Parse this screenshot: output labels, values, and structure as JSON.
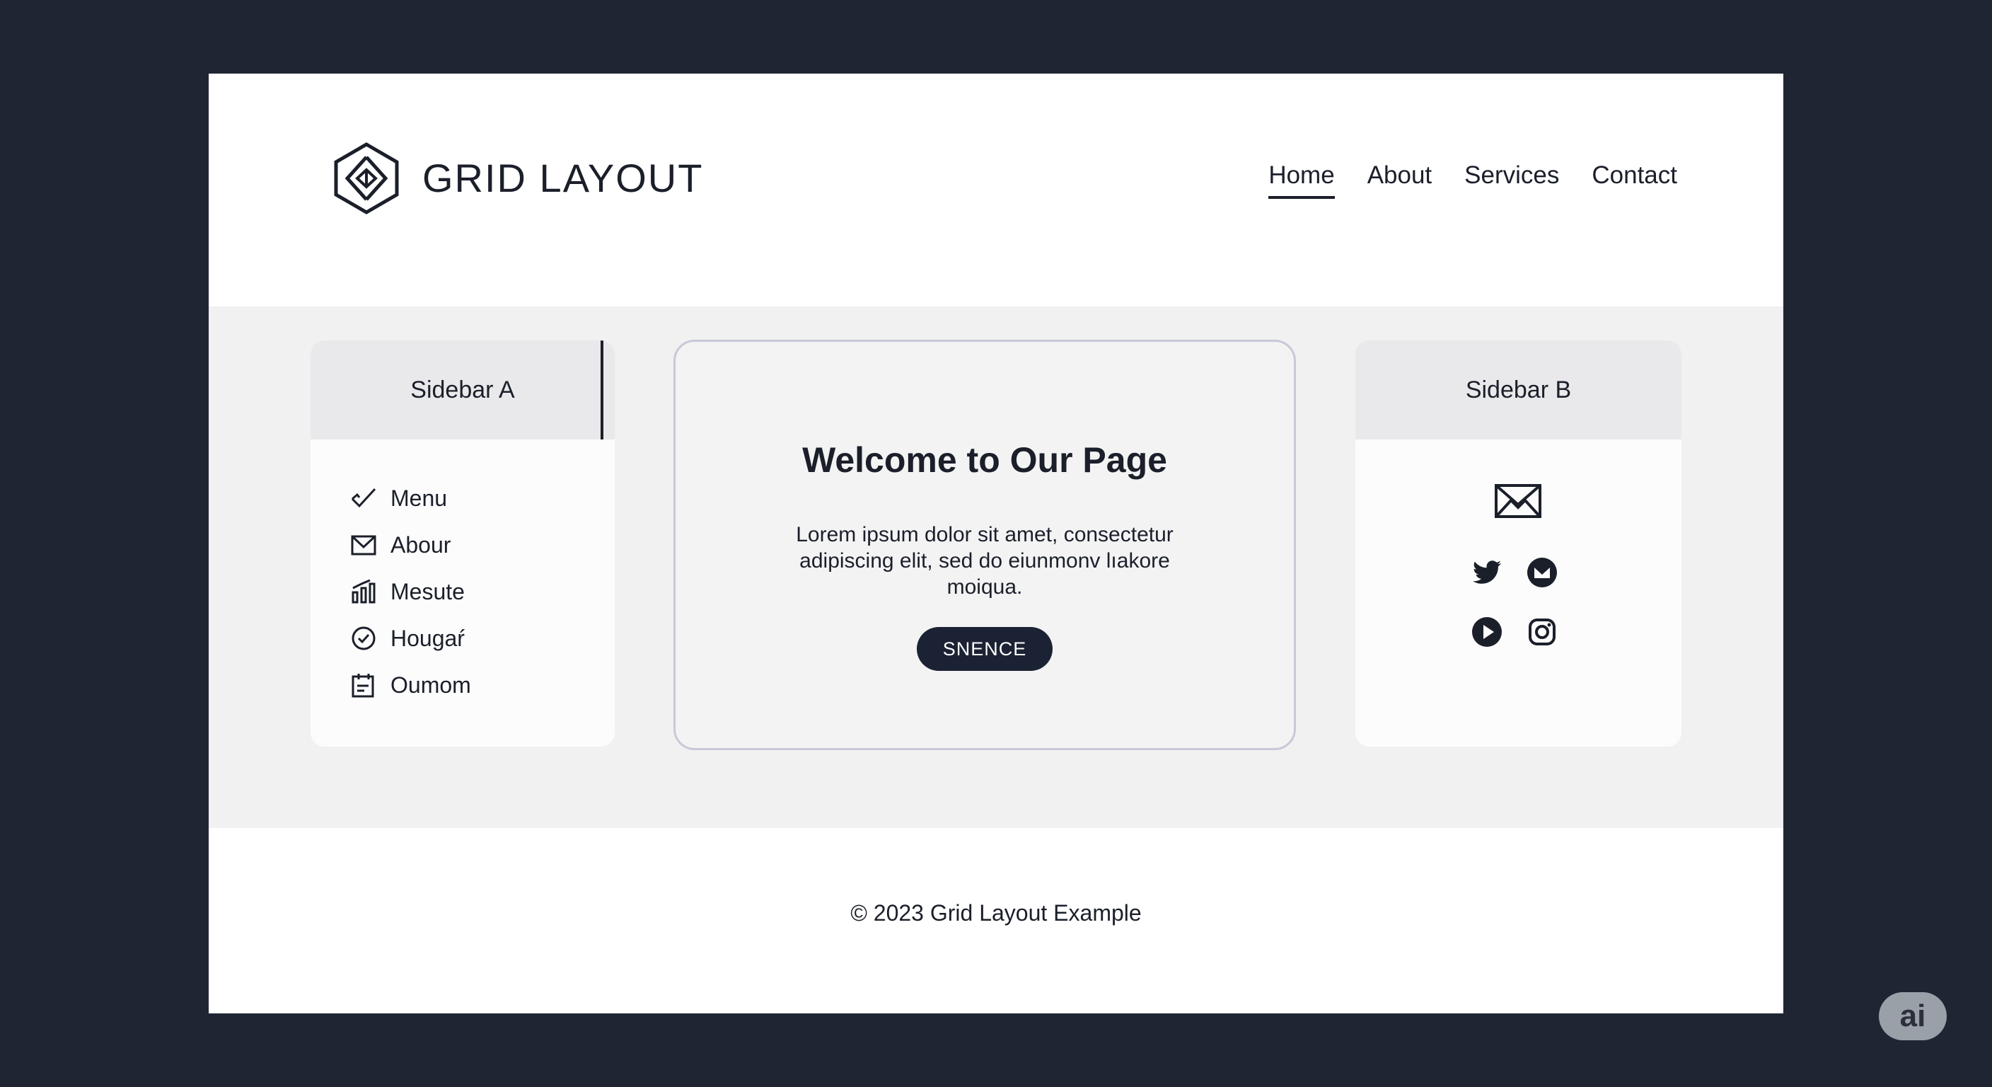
{
  "header": {
    "logo_text": "GRID LAYOUT",
    "nav": [
      {
        "label": "Home",
        "active": true
      },
      {
        "label": "About",
        "active": false
      },
      {
        "label": "Services",
        "active": false
      },
      {
        "label": "Contact",
        "active": false
      }
    ]
  },
  "sidebar_a": {
    "title": "Sidebar A",
    "items": [
      {
        "label": "Menu",
        "icon": "check-icon"
      },
      {
        "label": "Abour",
        "icon": "mail-icon"
      },
      {
        "label": "Mesute",
        "icon": "bar-chart-icon"
      },
      {
        "label": "Hougaŕ",
        "icon": "clock-icon"
      },
      {
        "label": "Oumom",
        "icon": "calendar-icon"
      }
    ]
  },
  "main": {
    "title": "Welcome to Our Page",
    "body_line1": "Lorem ipsum dolor sit amet, consectetur",
    "body_line2": "adipiscing elit, sed do eiunmonv lıakore",
    "body_line3": "moiqua.",
    "button_label": "SNENCE"
  },
  "sidebar_b": {
    "title": "Sidebar B",
    "icons": [
      "mail-icon",
      "twitter-icon",
      "email-circle-icon",
      "play-icon",
      "instagram-icon"
    ]
  },
  "footer": {
    "text": "© 2023 Grid Layout Example"
  },
  "badge": {
    "text": "ai"
  },
  "colors": {
    "background": "#1f2533",
    "page": "#ffffff",
    "band": "#f1f1f2",
    "text": "#1b1f2a",
    "button": "#1b2233"
  }
}
